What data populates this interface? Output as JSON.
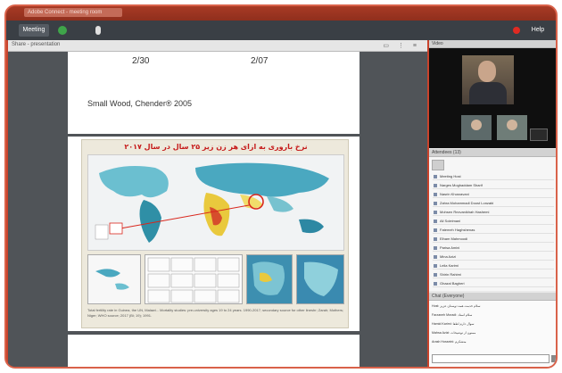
{
  "window": {
    "title": "Adobe Connect - meeting room"
  },
  "toolbar": {
    "meeting_label": "Meeting",
    "help_label": "Help"
  },
  "share_pod": {
    "label": "Share - presentation",
    "controls": "▭ ⋮ ≡",
    "slide_top": {
      "num1": "2/30",
      "num2": "2/07",
      "reference": "Small Wood, Chender® 2005"
    },
    "slide_title": "نرخ باروری به ازای هر زن زیر ۲۵ سال در سال ۲۰۱۷",
    "caption": "Total fertility rate in Guinea, the UN, Malawi... Mortality studies: pre-university ages 19 to 24 years. 1990-2017; secondary source for other lineshr; Zarah; Mothers; Niger; WHO source; 2017 (Bi; 19); 1991."
  },
  "video_pod": {
    "label": "Video"
  },
  "attendees_pod": {
    "label": "Attendees (13)",
    "items": [
      "Meeting Host",
      "Narges Moghaddam Sharif",
      "Nasrin Khosravani",
      "Zahra Mohammadi Doost Lonzabi",
      "Mohsen Rezvanikhah Hashemi",
      "Ali Soleimani",
      "Fatemeh Haghshenas",
      "Elham Mahmoodi",
      "Parisa Amini",
      "Mina Azizi",
      "Leila Karimi",
      "Shirin Rahimi",
      "Ghazal Bagheri"
    ]
  },
  "chat_pod": {
    "label": "Chat (Everyone)",
    "messages": [
      "Host: سلام خدمت همه دوستان عزیز",
      "Farzaneh Moradi: سلام استاد",
      "Hamid Karimi: سوال دارم لطفا",
      "Mahsa Azizi: ممنون از توضیحات",
      "Arash Hosseini: متشکرم"
    ]
  }
}
